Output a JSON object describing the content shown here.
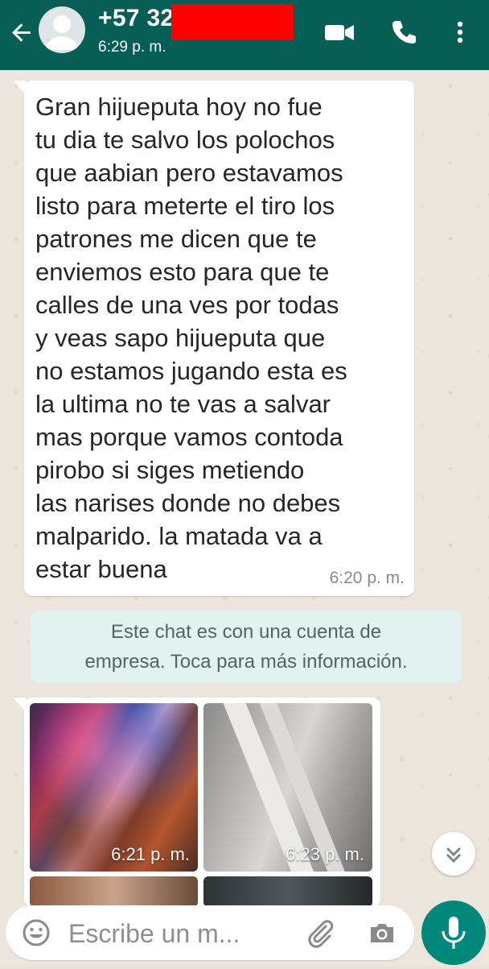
{
  "header": {
    "contact_name": "+57 32",
    "last_seen": "6:29 p. m.",
    "back_icon": "arrow-left-icon",
    "video_icon": "videocam-icon",
    "call_icon": "phone-icon",
    "menu_icon": "more-vert-icon",
    "background_color": "#075e54"
  },
  "messages": [
    {
      "type": "incoming-text",
      "text": "Gran hijueputa hoy no fue\ntu dia te salvo los polochos\nque aabian pero estavamos\nlisto para meterte el tiro los\npatrones me dicen que te\nenviemos esto para que te\ncalles de una ves por todas\ny veas sapo hijueputa que\nno estamos jugando esta es\nla ultima no te vas a salvar\nmas porque vamos contoda\npirobo si siges metiendo\nlas narises donde no debes\nmalparido. la matada va a\nestar buena",
      "time": "6:20 p. m."
    }
  ],
  "notice": {
    "text": "Este chat es con una cuenta de\nempresa. Toca para más información.",
    "background_color": "#e1f2f0"
  },
  "album": {
    "photos": [
      {
        "time": "6:21 p. m."
      },
      {
        "time": "6:23 p. m."
      }
    ]
  },
  "scroll_button": {
    "icon": "chevrons-down-icon"
  },
  "composer": {
    "placeholder": "Escribe un m...",
    "emoji_icon": "emoji-icon",
    "attach_icon": "paperclip-icon",
    "camera_icon": "camera-icon",
    "mic_icon": "mic-icon",
    "accent_color": "#00897b"
  }
}
